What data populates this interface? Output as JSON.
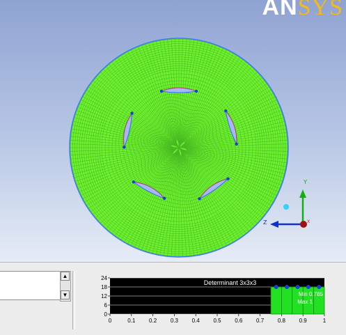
{
  "logo": {
    "part1": "AN",
    "part2": "SYS"
  },
  "viewport": {
    "axes": {
      "y_label": "Y",
      "z_label": "Z",
      "x_label": "X"
    },
    "colors": {
      "mesh": "#7cf23a",
      "boundary": "#2e6cff",
      "blade_fill": "#a9b6f5",
      "blade_edge": "#d04020"
    }
  },
  "console": {
    "scroll_up": "▲",
    "scroll_down": "▼"
  },
  "chart_data": {
    "type": "bar",
    "title": "Determinant 3x3x3",
    "x_ticks": [
      "0",
      "0.1",
      "0.2",
      "0.3",
      "0.4",
      "0.5",
      "0.6",
      "0.7",
      "0.8",
      "0.9",
      "1"
    ],
    "y_ticks": [
      "0",
      "6",
      "12",
      "18",
      "24"
    ],
    "xlim": [
      0,
      1
    ],
    "ylim": [
      0,
      24
    ],
    "bins": [
      {
        "x0": 0.75,
        "x1": 0.8,
        "value": 18
      },
      {
        "x0": 0.8,
        "x1": 0.85,
        "value": 18
      },
      {
        "x0": 0.85,
        "x1": 0.9,
        "value": 18
      },
      {
        "x0": 0.9,
        "x1": 0.95,
        "value": 18
      },
      {
        "x0": 0.95,
        "x1": 1.0,
        "value": 18
      }
    ],
    "min_label": "Min 0.785",
    "max_label": "Max 1",
    "bar_color": "#22e022"
  }
}
